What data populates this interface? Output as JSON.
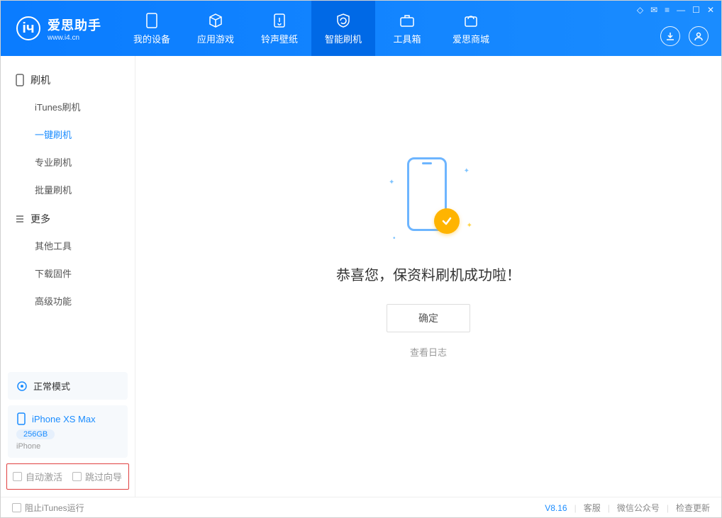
{
  "app": {
    "title": "爱思助手",
    "subtitle": "www.i4.cn"
  },
  "nav": {
    "items": [
      {
        "label": "我的设备",
        "icon": "device"
      },
      {
        "label": "应用游戏",
        "icon": "cube"
      },
      {
        "label": "铃声壁纸",
        "icon": "music"
      },
      {
        "label": "智能刷机",
        "icon": "refresh"
      },
      {
        "label": "工具箱",
        "icon": "toolbox"
      },
      {
        "label": "爱思商城",
        "icon": "shop"
      }
    ],
    "active_index": 3
  },
  "sidebar": {
    "section1": {
      "title": "刷机",
      "items": [
        "iTunes刷机",
        "一键刷机",
        "专业刷机",
        "批量刷机"
      ],
      "active_index": 1
    },
    "section2": {
      "title": "更多",
      "items": [
        "其他工具",
        "下载固件",
        "高级功能"
      ]
    },
    "mode_card": {
      "label": "正常模式"
    },
    "device_card": {
      "name": "iPhone XS Max",
      "storage": "256GB",
      "type": "iPhone"
    },
    "checkboxes": {
      "auto_activate": "自动激活",
      "skip_guide": "跳过向导"
    }
  },
  "main": {
    "success_text": "恭喜您，保资料刷机成功啦！",
    "ok_button": "确定",
    "view_log": "查看日志"
  },
  "footer": {
    "block_itunes": "阻止iTunes运行",
    "version": "V8.16",
    "links": [
      "客服",
      "微信公众号",
      "检查更新"
    ]
  }
}
